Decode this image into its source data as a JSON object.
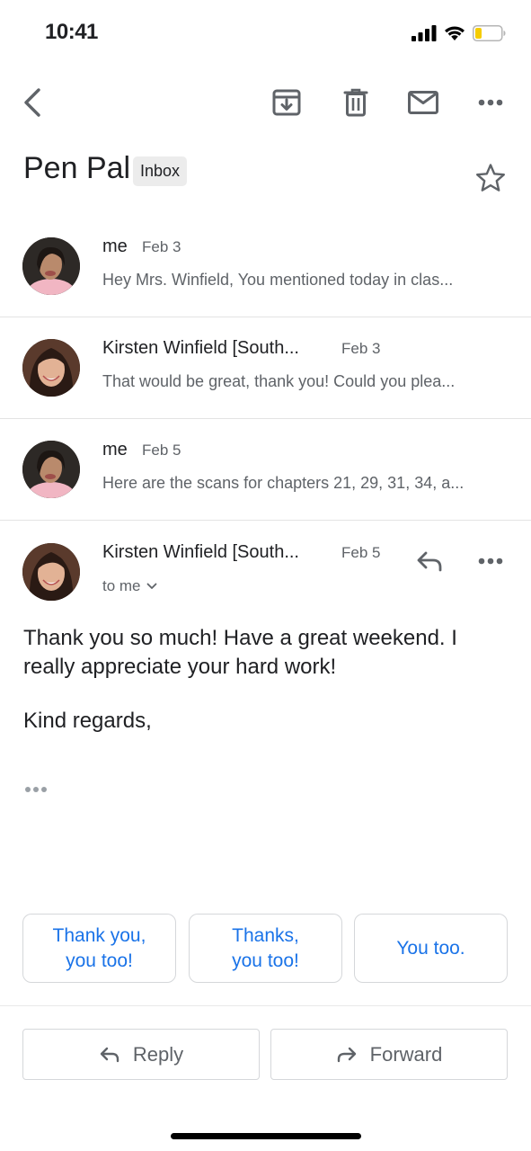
{
  "status_bar": {
    "time": "10:41"
  },
  "toolbar": {
    "icons": [
      "back-icon",
      "archive-icon",
      "trash-icon",
      "mail-icon",
      "more-icon"
    ]
  },
  "thread": {
    "subject": "Pen Pal",
    "label": "Inbox"
  },
  "messages": [
    {
      "sender": "me",
      "date": "Feb 3",
      "snippet": "Hey Mrs. Winfield, You mentioned today in clas..."
    },
    {
      "sender": "Kirsten Winfield [South...",
      "date": "Feb 3",
      "snippet": "That would be great, thank you! Could you plea..."
    },
    {
      "sender": "me",
      "date": "Feb 5",
      "snippet": "Here are the scans for chapters 21, 29, 31, 34, a..."
    }
  ],
  "expanded_message": {
    "sender": "Kirsten Winfield [South...",
    "date": "Feb 5",
    "recipient": "to me",
    "body": "Thank you so much! Have a great weekend. I really appreciate your hard work!",
    "closing": "Kind regards,"
  },
  "smart_replies": [
    {
      "line1": "Thank you,",
      "line2": "you too!"
    },
    {
      "line1": "Thanks,",
      "line2": "you too!"
    },
    {
      "line1": "You too.",
      "line2": ""
    }
  ],
  "actions": {
    "reply_label": "Reply",
    "forward_label": "Forward"
  },
  "colors": {
    "accent": "#1a73e8",
    "secondary_text": "#5f6368",
    "primary_text": "#202124"
  }
}
